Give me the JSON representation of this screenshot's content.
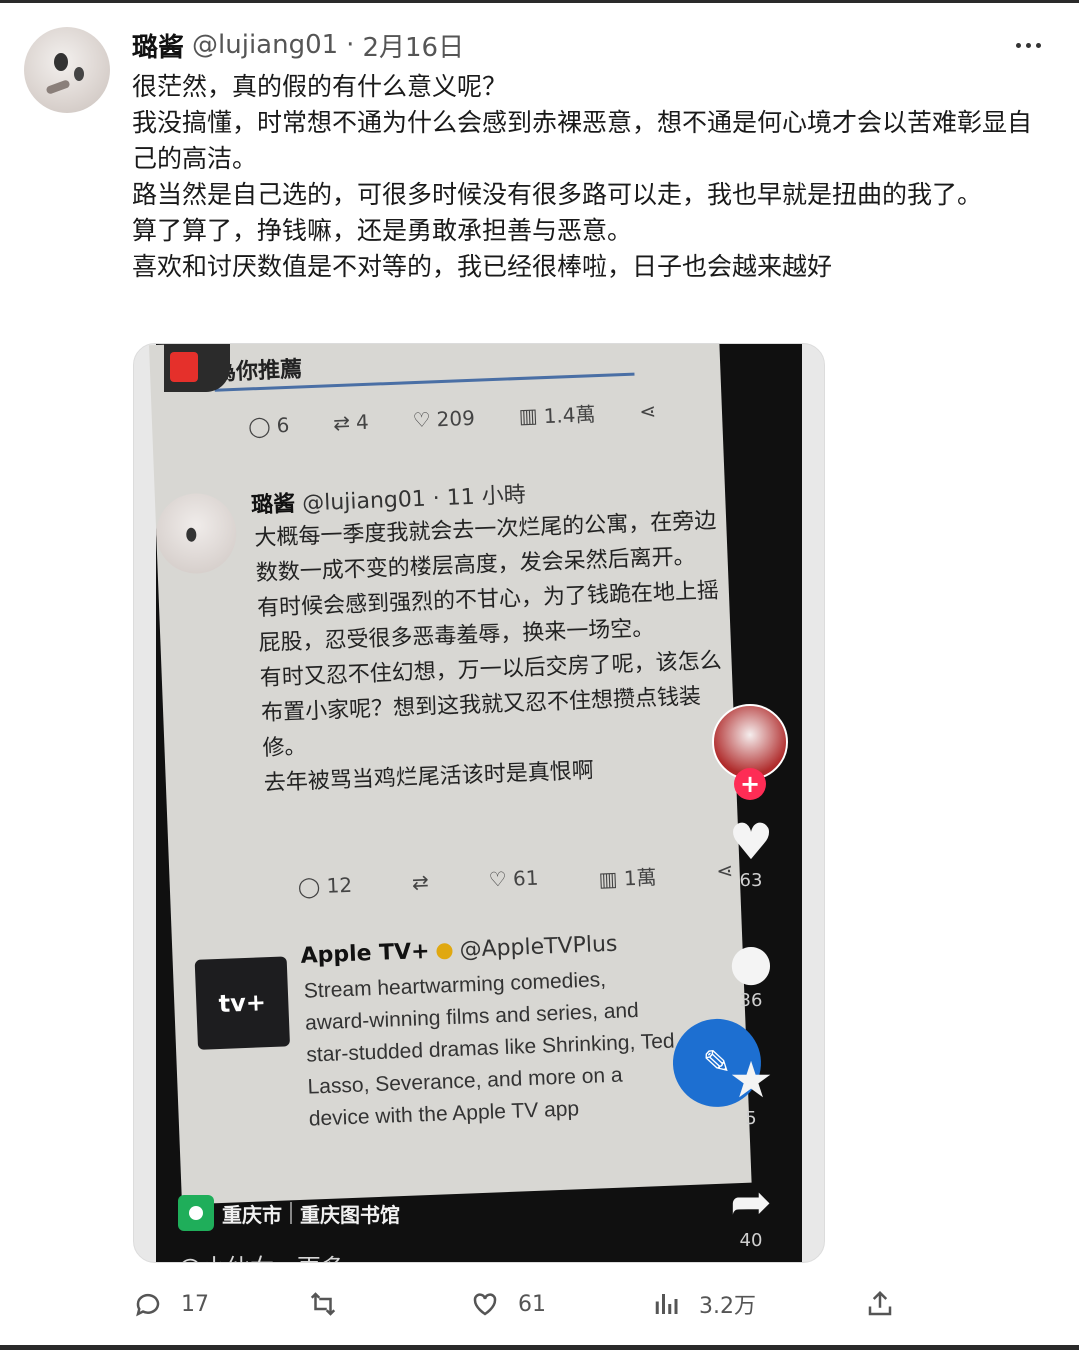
{
  "tweet": {
    "author_name": "璐酱",
    "handle": "@lujiang01",
    "date_separator": "·",
    "date": "2月16日",
    "paragraphs": [
      "很茫然，真的假的有什么意义呢？",
      "我没搞懂，时常想不通为什么会感到赤裸恶意，想不通是何心境才会以苦难彰显自己的高洁。",
      "路当然是自己选的，可很多时候没有很多路可以走，我也早就是扭曲的我了。",
      "算了算了，挣钱嘛，还是勇敢承担善与恶意。",
      "喜欢和讨厌数值是不对等的，我已经很棒啦，日子也会越来越好"
    ],
    "actions": {
      "reply_count": "17",
      "like_count": "61",
      "views_count": "3.2万"
    }
  },
  "embedded": {
    "top_label": "為你推薦",
    "top_stats": {
      "reply": "6",
      "retweet": "4",
      "like": "209",
      "views": "1.4萬"
    },
    "inner_author": "璐酱",
    "inner_handle": "@lujiang01",
    "inner_time": "· 11 小時",
    "inner_paragraphs": [
      "大概每一季度我就会去一次烂尾的公寓，在旁边数数一成不变的楼层高度，发会呆然后离开。",
      "有时候会感到强烈的不甘心，为了钱跪在地上摇屁股，忍受很多恶毒羞辱，换来一场空。",
      "有时又忍不住幻想，万一以后交房了呢，该怎么布置小家呢？想到这我就又忍不住想攒点钱装修。",
      "去年被骂当鸡烂尾活该时是真恨啊"
    ],
    "inner_stats": {
      "reply": "12",
      "like": "61",
      "views": "1萬"
    },
    "ad_name": "Apple TV+",
    "ad_handle": "@AppleTVPlus",
    "ad_logo": "tv+",
    "ad_lines": [
      "Stream heartwarming comedies,",
      "award-winning films and series, and",
      "star-studded dramas like Shrinking, Ted",
      "Lasso, Severance, and more on a",
      "device with the Apple TV app"
    ],
    "rail_counts": {
      "like": "63",
      "comment": "36",
      "favorite": "5",
      "share": "40"
    },
    "location_city": "重庆市",
    "location_place": "重庆图书馆",
    "cut_text": "@小仙女 · 更多"
  },
  "icons": {
    "reply": "reply-icon",
    "retweet": "retweet-icon",
    "like": "heart-icon",
    "views": "views-icon",
    "share": "share-icon",
    "more": "more-icon"
  },
  "colors": {
    "text": "#1a1a1a",
    "muted": "#555555",
    "fab": "#1d6fd1",
    "follow_plus": "#fe2c55",
    "location_pin": "#1fae5a"
  }
}
